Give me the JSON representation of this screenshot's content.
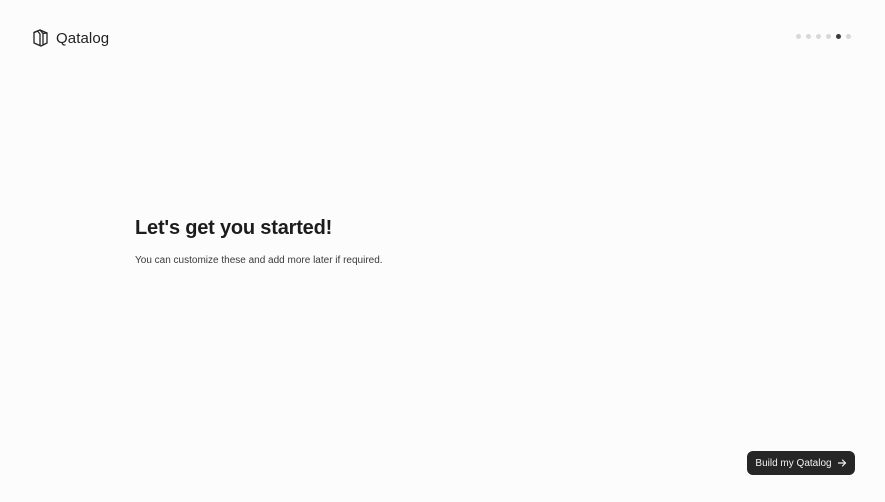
{
  "brand": {
    "name": "Qatalog",
    "logo_icon": "qatalog-logo-icon"
  },
  "progress": {
    "total_steps": 6,
    "current_step": 5
  },
  "main": {
    "title": "Let's get you started!",
    "subtitle": "You can customize these and add more later if required."
  },
  "cta": {
    "label": "Build my Qatalog",
    "icon": "arrow-right-icon"
  },
  "colors": {
    "background": "#fdfcfc",
    "button_bg": "#262626",
    "dot_active": "#3b3b3b",
    "dot_inactive": "#d8d8d8"
  }
}
